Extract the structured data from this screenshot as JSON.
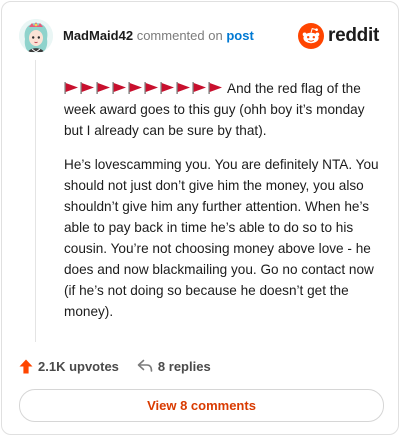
{
  "comment": {
    "username": "MadMaid42",
    "commented_on_text": "commented on",
    "post_link": "post",
    "flag_emoji_count": 10,
    "paragraph1": "And the red flag of the week award goes to this guy (ohh boy it’s monday but I already can be sure by that).",
    "paragraph2": "He’s lovescamming you. You are definitely NTA. You should not just don’t give him the money, you also shouldn’t give him any further attention. When he’s able to pay back in time he’s able to do so to his cousin. You’re not choosing money above love - he does and now blackmailing you. Go no contact now (if he’s not doing so because he doesn’t get the money)."
  },
  "brand": {
    "wordmark": "reddit",
    "accent_color": "#ff4500"
  },
  "actions": {
    "upvotes_label": "2.1K upvotes",
    "replies_label": "8 replies"
  },
  "view_button_label": "View 8 comments",
  "colors": {
    "link": "#0079d3",
    "upvote": "#ff4500",
    "view_button_text": "#d93a00"
  }
}
